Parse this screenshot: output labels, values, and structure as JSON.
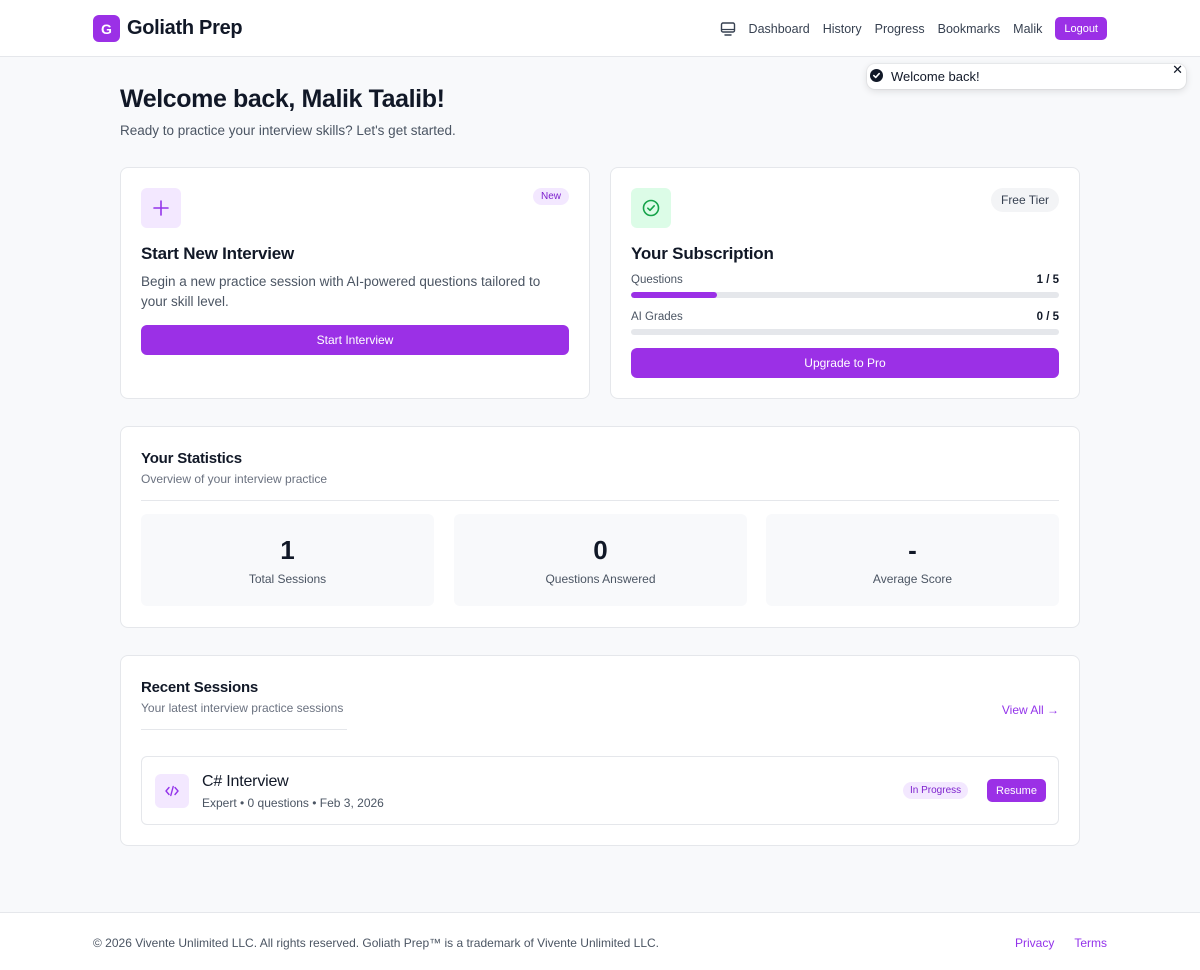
{
  "header": {
    "brand_letter": "G",
    "brand_name": "Goliath Prep",
    "nav": {
      "dashboard": "Dashboard",
      "history": "History",
      "progress": "Progress",
      "bookmarks": "Bookmarks",
      "user": "Malik",
      "logout": "Logout"
    },
    "icons": {
      "nav_icon": "monitor-icon"
    }
  },
  "toast": {
    "message": "Welcome back!",
    "close": "✕"
  },
  "welcome": {
    "title": "Welcome back, Malik Taalib!",
    "subtitle": "Ready to practice your interview skills? Let's get started."
  },
  "start_card": {
    "badge": "New",
    "title": "Start New Interview",
    "description": "Begin a new practice session with AI-powered questions tailored to your skill level.",
    "button": "Start Interview"
  },
  "subscription_card": {
    "badge": "Free Tier",
    "title": "Your Subscription",
    "usage": [
      {
        "label": "Questions",
        "value": "1 / 5",
        "fraction": 0.2
      },
      {
        "label": "AI Grades",
        "value": "0 / 5",
        "fraction": 0
      }
    ],
    "button": "Upgrade to Pro"
  },
  "statistics": {
    "title": "Your Statistics",
    "subtitle": "Overview of your interview practice",
    "items": [
      {
        "value": "1",
        "label": "Total Sessions"
      },
      {
        "value": "0",
        "label": "Questions Answered"
      },
      {
        "value": "-",
        "label": "Average Score"
      }
    ]
  },
  "recent_sessions": {
    "title": "Recent Sessions",
    "subtitle": "Your latest interview practice sessions",
    "view_all": "View All →",
    "sessions": [
      {
        "title": "C# Interview",
        "meta": "Expert • 0 questions • Feb 3, 2026",
        "status": "In Progress",
        "action": "Resume"
      }
    ]
  },
  "footer": {
    "copyright": "© 2026 Vivente Unlimited LLC. All rights reserved. Goliath Prep™ is a trademark of Vivente Unlimited LLC.",
    "privacy": "Privacy",
    "terms": "Terms"
  },
  "colors": {
    "accent": "#9b30e6",
    "accent_light": "#f3e8ff",
    "success_light": "#dcfce7",
    "success": "#16a34a"
  }
}
